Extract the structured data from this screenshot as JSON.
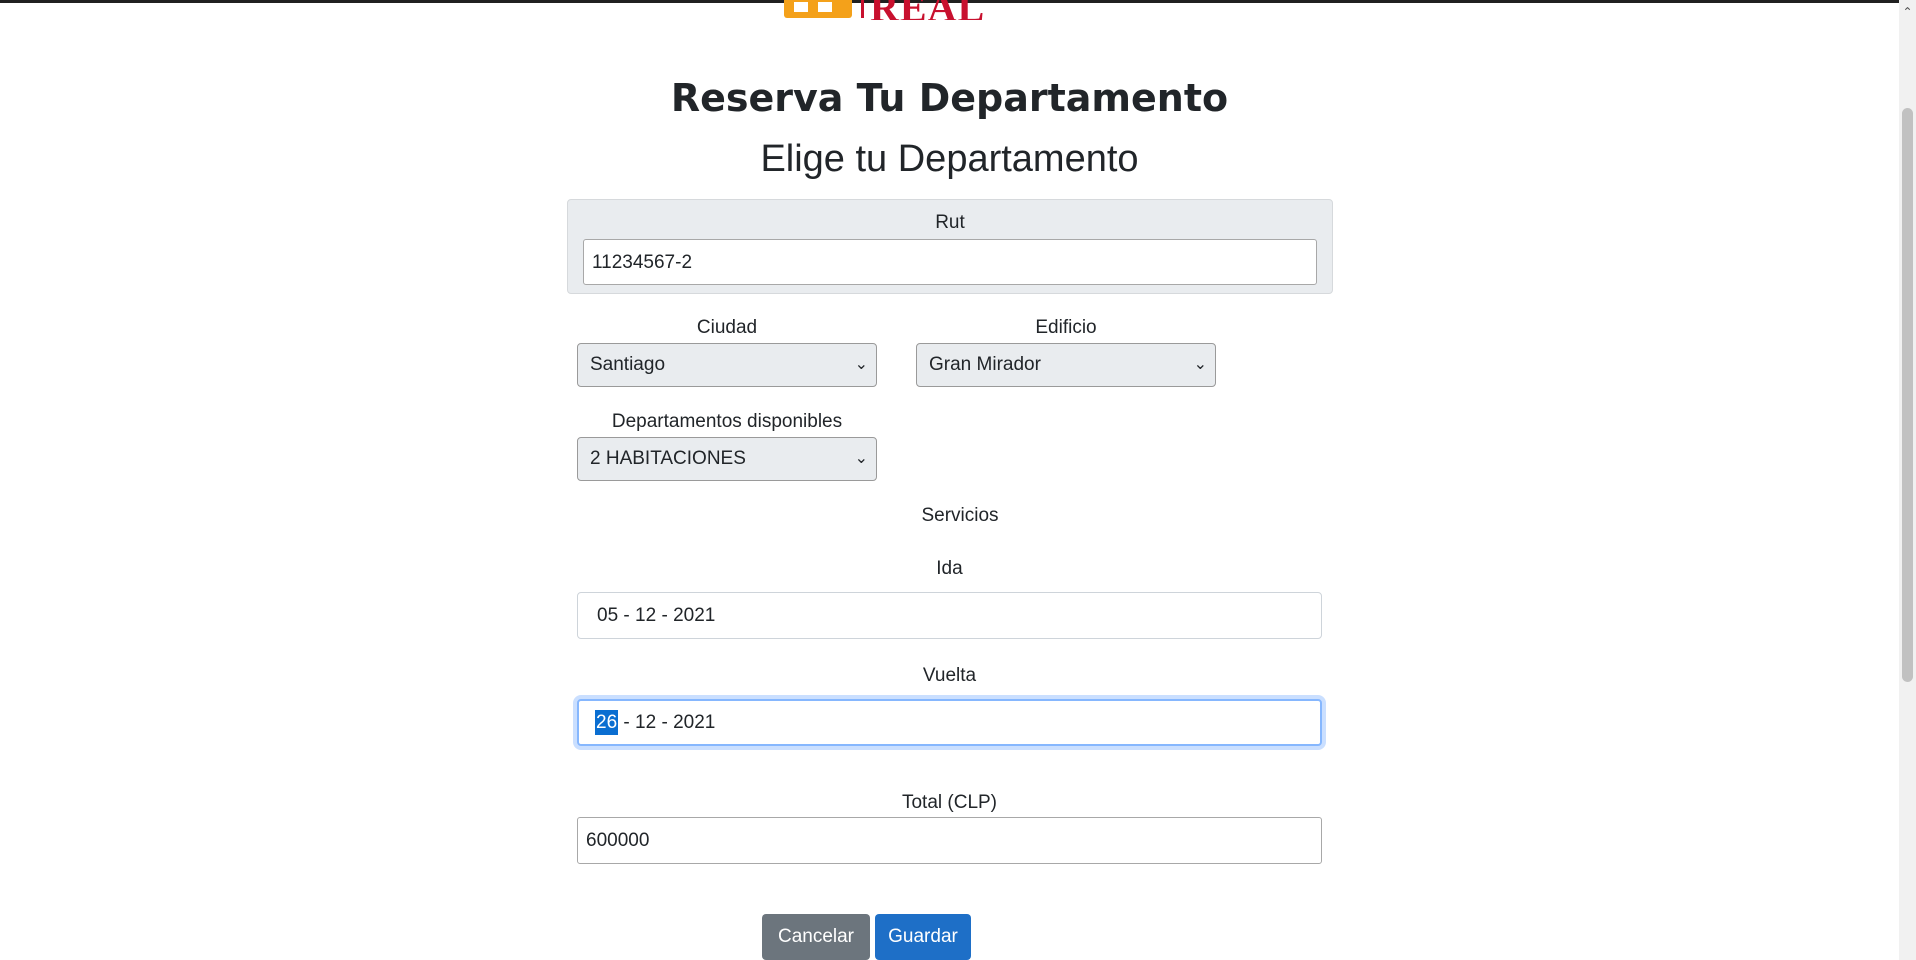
{
  "logo": {
    "text": "REAL"
  },
  "header": {
    "title": "Reserva Tu Departamento",
    "subtitle": "Elige tu Departamento"
  },
  "form": {
    "rut": {
      "label": "Rut",
      "value": "11234567-2"
    },
    "ciudad": {
      "label": "Ciudad",
      "selected": "Santiago"
    },
    "edificio": {
      "label": "Edificio",
      "selected": "Gran Mirador"
    },
    "departamentos": {
      "label": "Departamentos disponibles",
      "selected": "2 HABITACIONES"
    },
    "servicios": {
      "label": "Servicios"
    },
    "ida": {
      "label": "Ida",
      "day": "05",
      "month": "12",
      "year": "2021"
    },
    "vuelta": {
      "label": "Vuelta",
      "day": "26",
      "month": "12",
      "year": "2021"
    },
    "total": {
      "label": "Total (CLP)",
      "value": "600000"
    }
  },
  "actions": {
    "cancel_label": "Cancelar",
    "save_label": "Guardar"
  },
  "colors": {
    "cancel_button": "#6c757d",
    "save_button": "#1e6fc7",
    "logo_red": "#c8102e",
    "logo_orange": "#f4a11a",
    "focus_ring": "#86b7fe"
  },
  "icons": [
    "logo-icon",
    "chevron-down-icon",
    "scroll-up-arrow-icon"
  ]
}
